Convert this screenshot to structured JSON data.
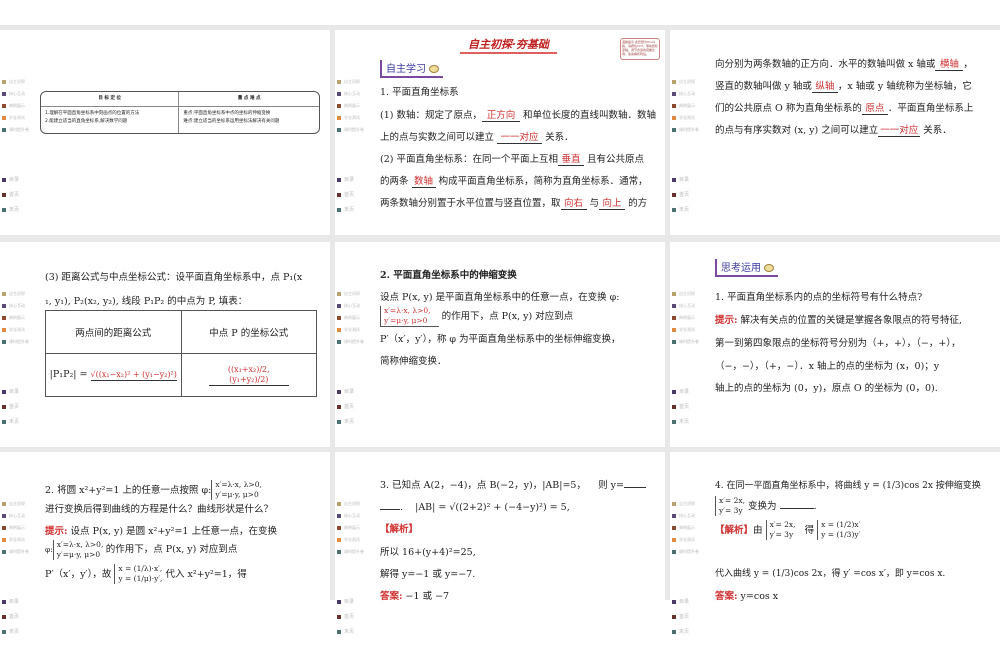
{
  "nav": {
    "items": [
      "自主初探",
      "核心互动",
      "典例展示",
      "学业测试",
      "课时提升卷"
    ],
    "bottom": [
      "目录",
      "首页",
      "末页"
    ],
    "colors": [
      "#b8a070",
      "#5a4a7a",
      "#8a4a30",
      "#e08a40",
      "#4a7070"
    ],
    "bottom_colors": [
      "#4a3a6a",
      "#6a3030",
      "#4a7070"
    ]
  },
  "s1": {
    "h1": "目 标 定 位",
    "h2": "重 点 难 点",
    "g1": "1.理解在平面直角坐标系中刻画点的位置的方法",
    "g2": "2.能建立适当的直角坐标系,解决数学问题",
    "k1": "重点:平面直角坐标系中点的坐标的伸缩变换",
    "k2": "难点:建立适当的坐标系运用坐标法解决有关问题"
  },
  "s2": {
    "banner": "自主初探·夯基础",
    "note": "温馨提示 此套题为Word版，请按住Ctrl，滑动鼠标滚轴，调节合适的观看比例，答案解析附后。",
    "label": "自主学习",
    "title": "1. 平面直角坐标系",
    "l1a": "(1) 数轴：规定了原点，",
    "a1": "正方向",
    "l1b": "和单位长度的直线叫数轴．数轴",
    "l2a": "上的点与实数之间可以建立",
    "a2": "一一对应",
    "l2b": "关系．",
    "l3a": "(2) 平面直角坐标系：在同一个平面上互相",
    "a3": "垂直",
    "l3b": "且有公共原点",
    "l4a": "的两条",
    "a4": "数轴",
    "l4b": "构成平面直角坐标系，简称为直角坐标系．通常，",
    "l5a": "两条数轴分别置于水平位置与竖直位置，取",
    "a5": "向右",
    "l5b": "与",
    "a6": "向上",
    "l5c": "的方"
  },
  "s3": {
    "l1a": "向分别为两条数轴的正方向．水平的数轴叫做 x 轴或",
    "a1": "横轴",
    "l1b": "，",
    "l2a": "竖直的数轴叫做 y 轴或",
    "a2": "纵轴",
    "l2b": "，x 轴或 y 轴统称为坐标轴，它",
    "l3a": "们的公共原点 O 称为直角坐标系的",
    "a3": "原点",
    "l3b": "．平面直角坐标系上",
    "l4a": "的点与有序实数对 (x, y) 之间可以建立",
    "a4": "一一对应",
    "l4b": "关系．"
  },
  "s4": {
    "l1": "(3) 距离公式与中点坐标公式：设平面直角坐标系中，点 P₁(x",
    "l2": "₁, y₁), P₂(x₂, y₂), 线段 P₁P₂ 的中点为 P, 填表：",
    "h1": "两点间的距离公式",
    "h2": "中点 P 的坐标公式",
    "c1a": "|P₁P₂| =",
    "c1b": "√((x₁−x₂)² + (y₁−y₂)²)",
    "c2": "((x₁+x₂)/2, (y₁+y₂)/2)"
  },
  "s5": {
    "title": "2. 平面直角坐标系中的伸缩变换",
    "l1": "设点 P(x, y) 是平面直角坐标系中的任意一点，在变换 φ:",
    "b1": "x′=λ·x, λ>0,",
    "b2": "y′=μ·y, μ>0",
    "l2": "的作用下，点 P(x, y) 对应到点",
    "l3": "P′（x′，y′），称 φ 为平面直角坐标系中的坐标伸缩变换，",
    "l4": "简称伸缩变换．"
  },
  "s6": {
    "label": "思考运用",
    "q": "1. 平面直角坐标系内的点的坐标符号有什么特点?",
    "hint": "提示:",
    "l1": "解决有关点的位置的关键是掌握各象限点的符号特征,",
    "l2": "第一到第四象限点的坐标符号分别为（+，+），（−，+），",
    "l3": "（−，−），（+，−）．x 轴上的点的坐标为 (x，0)；y",
    "l4": "轴上的点的坐标为 (0，y)，原点 O 的坐标为 (0，0)."
  },
  "s7": {
    "q1": "2. 将圆 x²+y²=1 上的任意一点按照 φ:",
    "b1": "x′=λ·x, λ>0,",
    "b2": "y′=μ·y, μ>0",
    "q2": "进行变换后得到曲线的方程是什么？曲线形状是什么？",
    "hint": "提示:",
    "l1": "设点 P(x, y) 是圆 x²+y²=1 上任意一点，在变换",
    "phi": "φ:",
    "l2": "的作用下，点 P(x, y) 对应到点",
    "l3a": "P′（x′，y′），故",
    "c1": "x = (1/λ)·x′,",
    "c2": "y = (1/μ)·y′,",
    "l3b": "代入 x²+y²=1，得"
  },
  "s8": {
    "q1": "3. 已知点 A(2，−4)，点 B(−2，y)，|AB|=5，",
    "q1b": "则 y=",
    "q2": ".",
    "f": "|AB| = √((2+2)² + (−4−y)²) = 5,",
    "jx": "【解析】",
    "l1": "所以 16+(y+4)²=25,",
    "l2": "解得 y=−1 或 y=−7.",
    "ans": "答案:",
    "ansv": "−1 或 −7"
  },
  "s9": {
    "q1": "4. 在同一平面直角坐标系中，将曲线 y = (1/3)cos 2x 按伸缩变换",
    "b1": "x′= 2x,",
    "b2": "y′= 3y",
    "q2": "变换为",
    "q3": ".",
    "jx": "【解析】",
    "you": "由",
    "de": "得",
    "c1": "x = (1/2)x′",
    "c2": "y = (1/3)y′",
    "l1": "代入曲线 y = (1/3)cos 2x，得 y′ =cos x′，即 y=cos x.",
    "ans": "答案:",
    "ansv": "y=cos x"
  }
}
